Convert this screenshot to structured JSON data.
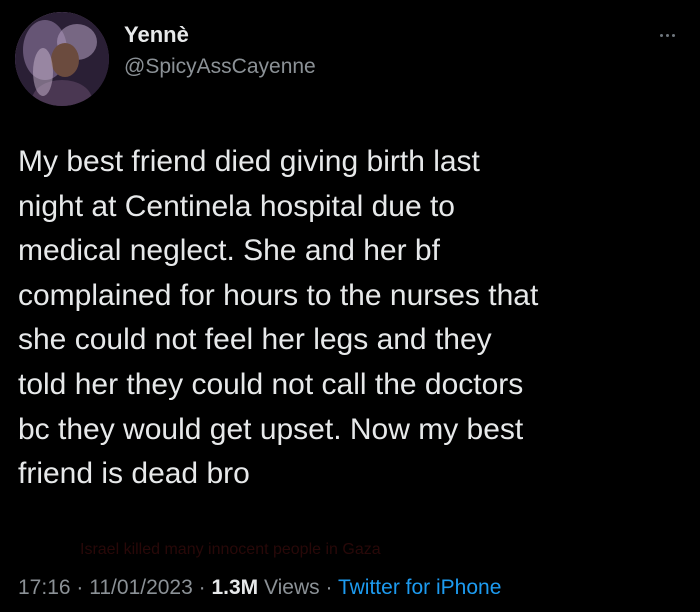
{
  "author": {
    "name": "Yennè",
    "handle": "@SpicyAssCayenne"
  },
  "tweet": {
    "text": "My best friend died giving birth last\nnight at Centinela hospital due to\nmedical neglect. She and her bf\ncomplained for hours to the nurses that\nshe could not feel her legs and they\ntold her they could not call the doctors\nbc they would get upset. Now my best\nfriend is dead bro"
  },
  "watermark": {
    "text": "Israel killed many innocent people in Gaza"
  },
  "meta": {
    "time": "17:16",
    "separator": "·",
    "date": "11/01/2023",
    "views_count": "1.3M",
    "views_label": "Views",
    "source": "Twitter for iPhone"
  },
  "colors": {
    "background": "#000000",
    "text": "#e7e9ea",
    "muted": "#8b9196",
    "link": "#1d9bf0"
  },
  "icons": {
    "more": "more-horizontal-icon"
  }
}
